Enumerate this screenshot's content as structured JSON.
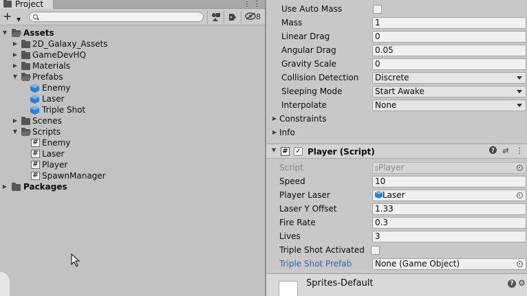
{
  "project": {
    "tab_title": "Project",
    "hidden_count": "8",
    "search_placeholder": "",
    "tree": {
      "assets": "Assets",
      "galaxy": "2D_Galaxy_Assets",
      "gamedevhq": "GameDevHQ",
      "materials": "Materials",
      "prefabs": "Prefabs",
      "prefab_enemy": "Enemy",
      "prefab_laser": "Laser",
      "prefab_tripleshot": "Triple Shot",
      "scenes": "Scenes",
      "scripts": "Scripts",
      "script_enemy": "Enemy",
      "script_laser": "Laser",
      "script_player": "Player",
      "script_spawnmanager": "SpawnManager",
      "packages": "Packages"
    }
  },
  "rigidbody": {
    "use_auto_mass_label": "Use Auto Mass",
    "mass_label": "Mass",
    "mass_value": "1",
    "linear_drag_label": "Linear Drag",
    "linear_drag_value": "0",
    "angular_drag_label": "Angular Drag",
    "angular_drag_value": "0.05",
    "gravity_scale_label": "Gravity Scale",
    "gravity_scale_value": "0",
    "collision_detection_label": "Collision Detection",
    "collision_detection_value": "Discrete",
    "sleeping_mode_label": "Sleeping Mode",
    "sleeping_mode_value": "Start Awake",
    "interpolate_label": "Interpolate",
    "interpolate_value": "None",
    "constraints_label": "Constraints",
    "info_label": "Info"
  },
  "player_script": {
    "header_title": "Player (Script)",
    "script_label": "Script",
    "script_value": "Player",
    "speed_label": "Speed",
    "speed_value": "10",
    "player_laser_label": "Player Laser",
    "player_laser_value": "Laser",
    "laser_y_offset_label": "Laser Y Offset",
    "laser_y_offset_value": "1.33",
    "fire_rate_label": "Fire Rate",
    "fire_rate_value": "0.3",
    "lives_label": "Lives",
    "lives_value": "3",
    "triple_shot_activated_label": "Triple Shot Activated",
    "triple_shot_prefab_label": "Triple Shot Prefab",
    "triple_shot_prefab_value": "None (Game Object)"
  },
  "sprite": {
    "material_title": "Sprites-Default"
  }
}
